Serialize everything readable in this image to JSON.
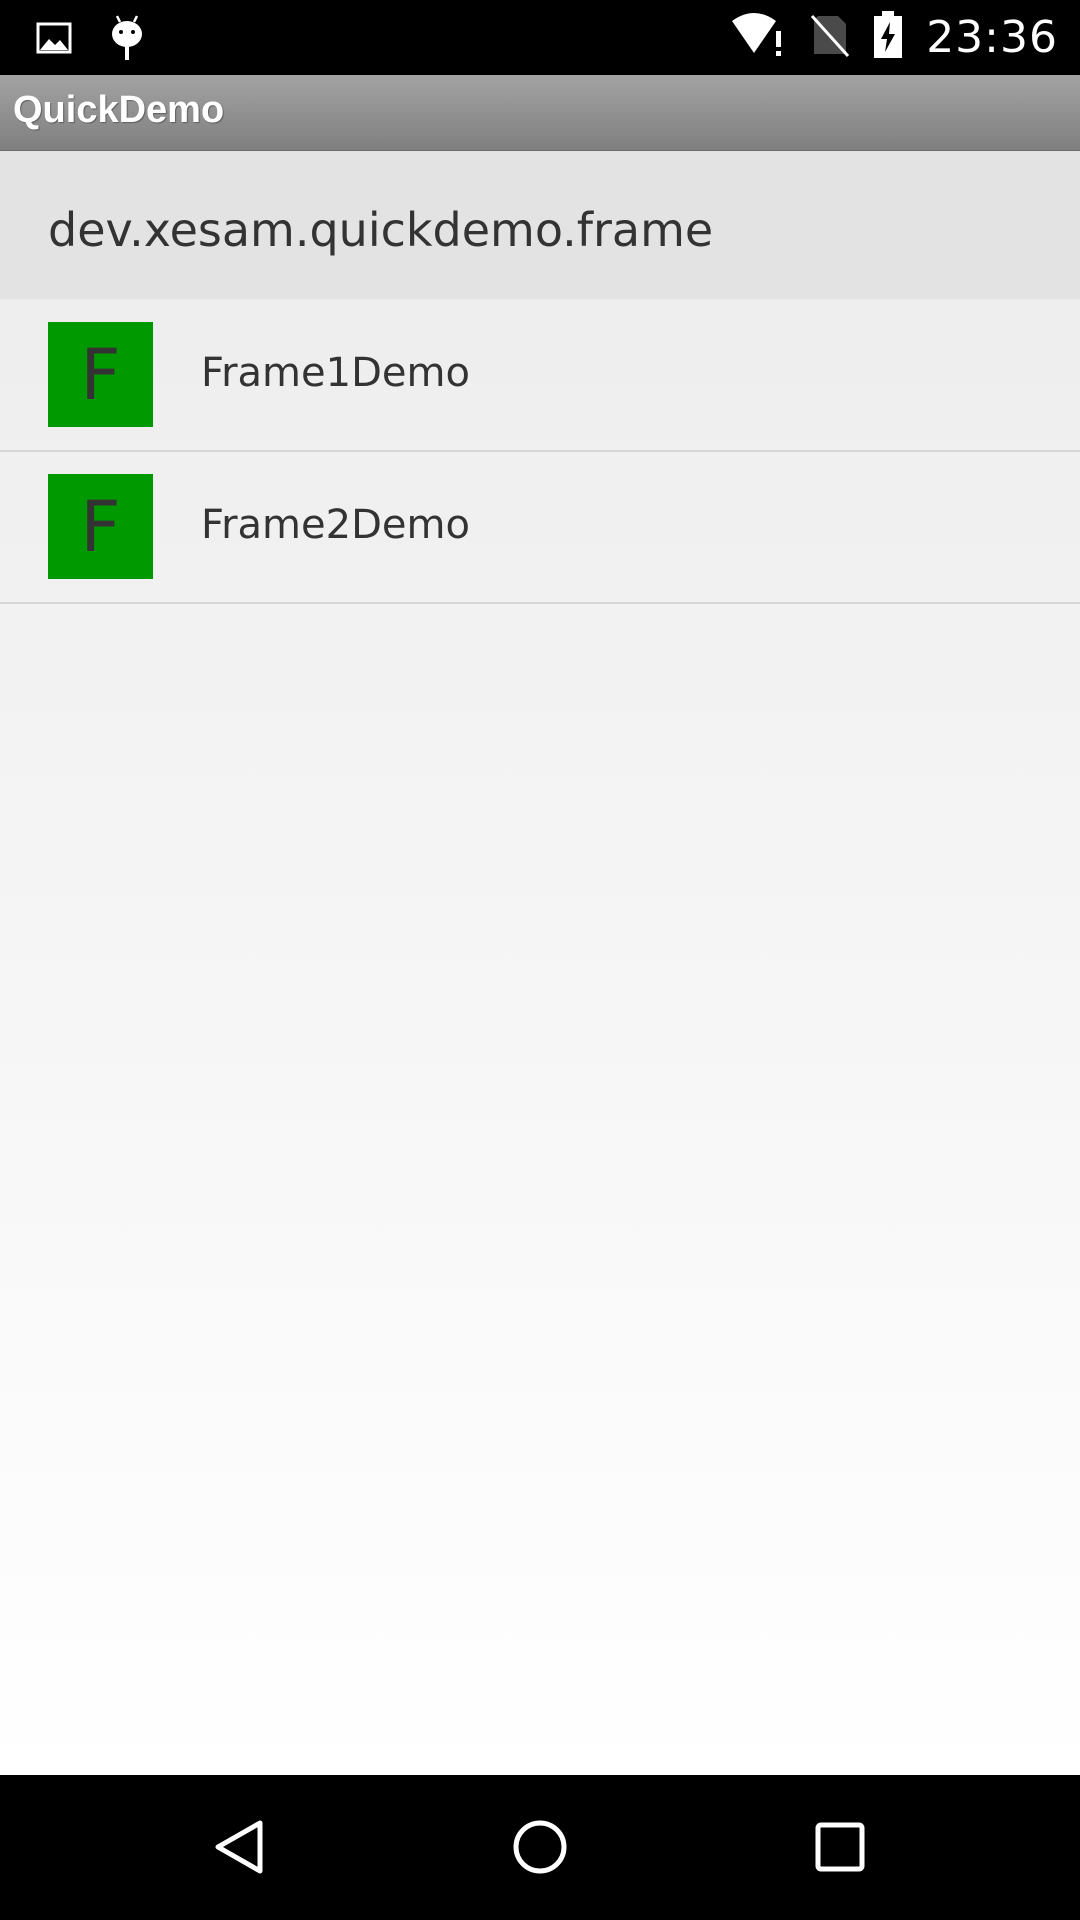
{
  "status_bar": {
    "time": "23:36",
    "icons_left": [
      "image-icon",
      "android-icon"
    ],
    "icons_right": [
      "wifi-alert-icon",
      "no-sim-icon",
      "battery-charging-icon"
    ]
  },
  "app_bar": {
    "title": "QuickDemo"
  },
  "section": {
    "title": "dev.xesam.quickdemo.frame"
  },
  "items": [
    {
      "icon_letter": "F",
      "label": "Frame1Demo"
    },
    {
      "icon_letter": "F",
      "label": "Frame2Demo"
    }
  ],
  "colors": {
    "icon_background": "#009900",
    "app_bar": "#8f8f8f",
    "section_header": "#e3e3e3"
  },
  "nav_bar": {
    "buttons": [
      "back-icon",
      "home-icon",
      "recents-icon"
    ]
  }
}
